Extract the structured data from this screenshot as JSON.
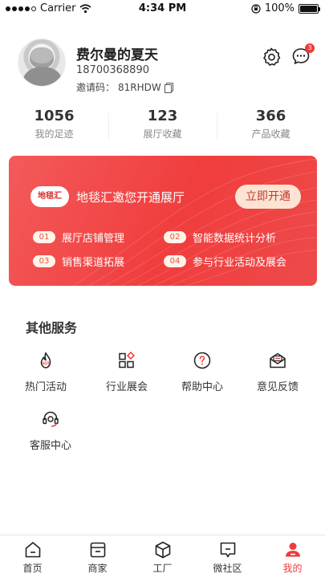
{
  "status_bar": {
    "carrier": "Carrier",
    "time": "4:34 PM",
    "battery_text": "100%",
    "battery_level": 1.0,
    "icons": [
      "signal-dots-icon",
      "wifi-icon",
      "rotation-lock-icon",
      "battery-icon"
    ]
  },
  "profile": {
    "name": "费尔曼的夏天",
    "phone": "18700368890",
    "invite_label": "邀请码：",
    "invite_code": "81RHDW",
    "message_badge": "3",
    "icons": [
      "settings-icon",
      "message-icon",
      "copy-icon"
    ]
  },
  "stats": [
    {
      "value": "1056",
      "label": "我的足迹"
    },
    {
      "value": "123",
      "label": "展厅收藏"
    },
    {
      "value": "366",
      "label": "产品收藏"
    }
  ],
  "banner": {
    "logo_text": "地毯汇",
    "title": "地毯汇邀您开通展厅",
    "button": "立即开通",
    "benefits": [
      {
        "num": "01",
        "text": "展厅店铺管理"
      },
      {
        "num": "02",
        "text": "智能数据统计分析"
      },
      {
        "num": "03",
        "text": "销售渠道拓展"
      },
      {
        "num": "04",
        "text": "参与行业活动及展会"
      }
    ]
  },
  "services": {
    "title": "其他服务",
    "items": [
      {
        "label": "热门活动",
        "icon": "hot-activity-icon"
      },
      {
        "label": "行业展会",
        "icon": "expo-grid-icon"
      },
      {
        "label": "帮助中心",
        "icon": "help-icon"
      },
      {
        "label": "意见反馈",
        "icon": "feedback-icon"
      },
      {
        "label": "客服中心",
        "icon": "customer-service-icon"
      }
    ]
  },
  "tab_bar": {
    "items": [
      {
        "label": "首页",
        "icon": "home-icon"
      },
      {
        "label": "商家",
        "icon": "shop-icon"
      },
      {
        "label": "工厂",
        "icon": "factory-cube-icon"
      },
      {
        "label": "微社区",
        "icon": "community-icon"
      },
      {
        "label": "我的",
        "icon": "profile-icon"
      }
    ],
    "active_index": 4
  },
  "colors": {
    "accent": "#f03b3b",
    "banner_start": "#f45a5a",
    "banner_end": "#ee4a4a",
    "button_bg": "#fde3d3"
  }
}
